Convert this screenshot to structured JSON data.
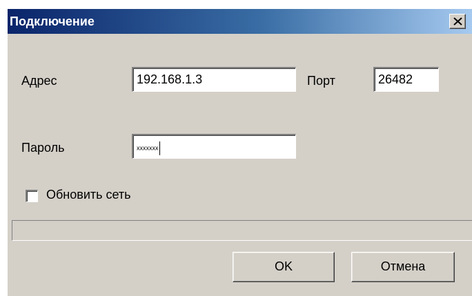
{
  "window": {
    "title": "Подключение",
    "close_glyph": "×",
    "close_icon": "close-icon"
  },
  "form": {
    "address_label": "Адрес",
    "address_value": "192.168.1.3",
    "port_label": "Порт",
    "port_value": "26482",
    "password_label": "Пароль",
    "password_value": "xxxxxxx",
    "refresh_network_label": "Обновить сеть",
    "refresh_network_checked": false
  },
  "progress": {
    "value": 0
  },
  "buttons": {
    "ok_label": "OK",
    "cancel_label": "Отмена"
  },
  "colors": {
    "title_bar_start": "#0a246a",
    "title_bar_end": "#a6caf0",
    "window_background": "#d4d0c8"
  }
}
